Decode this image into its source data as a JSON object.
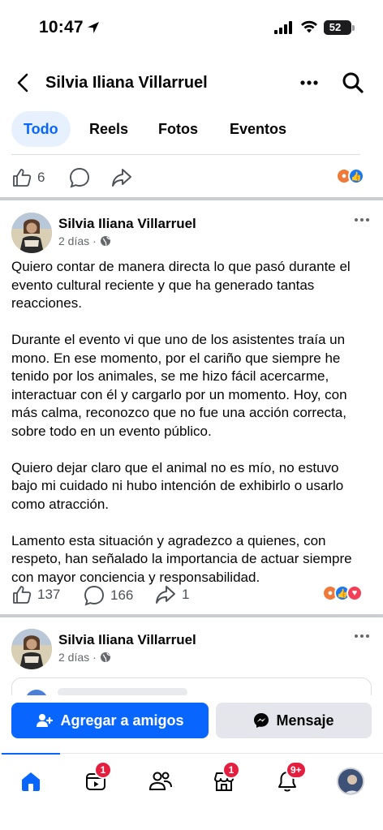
{
  "status_bar": {
    "time": "10:47",
    "battery": "52",
    "battery_level": 0.52
  },
  "header": {
    "title": "Silvia Iliana Villarruel"
  },
  "tabs": [
    {
      "label": "Todo",
      "active": true
    },
    {
      "label": "Reels",
      "active": false
    },
    {
      "label": "Fotos",
      "active": false
    },
    {
      "label": "Eventos",
      "active": false
    }
  ],
  "prev_post_actions": {
    "likes": "6",
    "reactions": [
      "angry",
      "like"
    ]
  },
  "posts": [
    {
      "author": "Silvia Iliana Villarruel",
      "time": "2 días",
      "paragraphs": [
        "Quiero contar de manera directa lo que pasó durante el evento cultural reciente y que ha generado tantas reacciones.",
        "Durante el evento vi que uno de los asistentes traía un mono. En ese momento, por el cariño que siempre he tenido por los animales, se me hizo fácil acercarme, interactuar con él y cargarlo por un momento. Hoy, con más calma, reconozco que no fue una acción correcta, sobre todo en un evento público.",
        "Quiero dejar claro que el animal no es mío, no estuvo bajo mi cuidado ni hubo intención de exhibirlo o usarlo como atracción.",
        "Lamento esta situación y agradezco a quienes, con respeto, han señalado la importancia de actuar siempre con mayor conciencia y responsabilidad."
      ],
      "likes": "137",
      "comments": "166",
      "shares": "1",
      "reactions": [
        "angry",
        "like",
        "love"
      ]
    },
    {
      "author": "Silvia Iliana Villarruel",
      "time": "2 días"
    }
  ],
  "cta": {
    "add_friend": "Agregar a amigos",
    "message": "Mensaje"
  },
  "bottom_nav": {
    "items": [
      "home-icon",
      "video-icon",
      "friends-icon",
      "marketplace-icon",
      "notifications-icon",
      "profile-avatar"
    ],
    "video_badge": "1",
    "marketplace_badge": "1",
    "notifications_badge": "9+"
  }
}
